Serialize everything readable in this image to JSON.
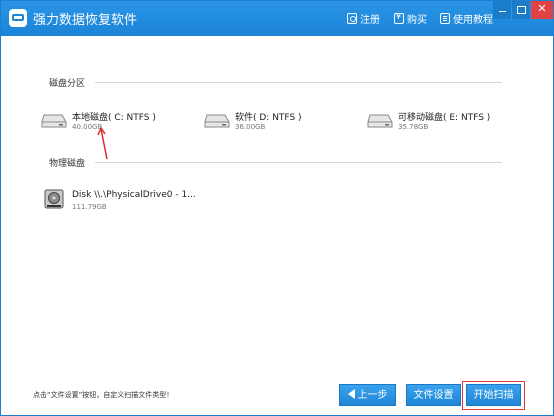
{
  "app": {
    "title": "强力数据恢复软件"
  },
  "titlebar": {
    "links": [
      {
        "label": "注册",
        "icon": "register-icon"
      },
      {
        "label": "购买",
        "icon": "yen-icon"
      },
      {
        "label": "使用教程",
        "icon": "tutorial-icon"
      }
    ]
  },
  "sections": {
    "partitions": "磁盘分区",
    "physical": "物理磁盘"
  },
  "partitions": [
    {
      "name": "本地磁盘( C: NTFS )",
      "size": "40.00GB"
    },
    {
      "name": "软件( D: NTFS )",
      "size": "36.00GB"
    },
    {
      "name": "可移动磁盘( E: NTFS )",
      "size": "35.78GB"
    }
  ],
  "physical_disks": [
    {
      "name": "Disk \\\\.\\PhysicalDrive0 - 1...",
      "size": "111.79GB"
    }
  ],
  "footer": {
    "hint": "点击“文件设置”按钮，自定义扫描文件类型！",
    "back_label": "上一步",
    "file_settings_label": "文件设置",
    "start_scan_label": "开始扫描"
  },
  "colors": {
    "accent": "#1b84d8",
    "highlight": "#e23c3c",
    "annotation_arrow": "#d9302b"
  }
}
